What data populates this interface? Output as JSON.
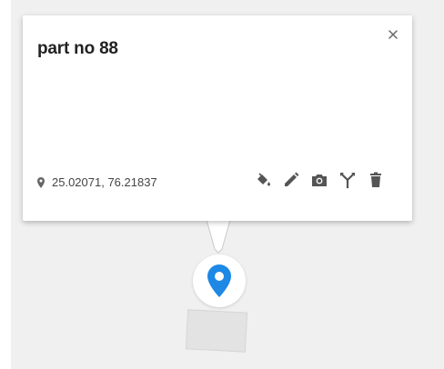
{
  "popup": {
    "title": "part no 88",
    "close_label": "×",
    "coordinates": "25.02071, 76.21837"
  },
  "actions": [
    {
      "icon": "paint-bucket-icon",
      "label": "color"
    },
    {
      "icon": "pencil-icon",
      "label": "edit"
    },
    {
      "icon": "camera-icon",
      "label": "photo"
    },
    {
      "icon": "fork-icon",
      "label": "route"
    },
    {
      "icon": "trash-icon",
      "label": "delete"
    }
  ],
  "colors": {
    "marker": "#1e88e5",
    "icon": "#555555",
    "map_background": "#f0f0f0"
  }
}
